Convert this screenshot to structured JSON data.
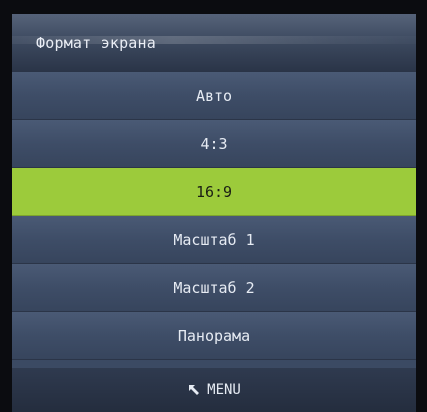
{
  "menu": {
    "title": "Формат экрана",
    "selected_index": 2,
    "options": [
      {
        "label": "Авто"
      },
      {
        "label": "4:3"
      },
      {
        "label": "16:9"
      },
      {
        "label": "Масштаб 1"
      },
      {
        "label": "Масштаб 2"
      },
      {
        "label": "Панорама"
      }
    ],
    "footer": {
      "back_icon": "back-arrow-icon",
      "back_label": "MENU"
    }
  },
  "colors": {
    "panel": "#3b4a63",
    "selected": "#9ccb3b",
    "text": "#e6ebf3"
  }
}
